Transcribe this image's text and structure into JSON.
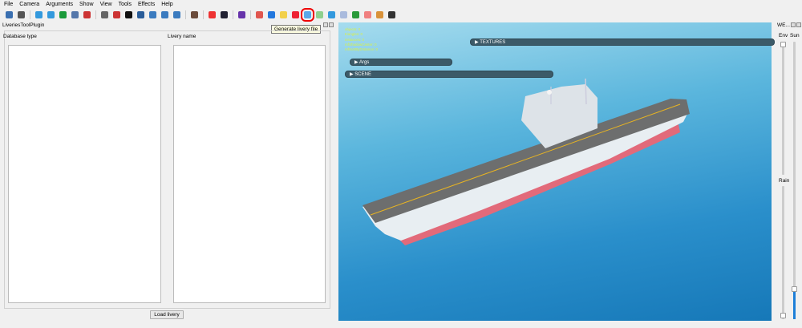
{
  "menu": [
    "File",
    "Camera",
    "Arguments",
    "Show",
    "View",
    "Tools",
    "Effects",
    "Help"
  ],
  "toolbar": {
    "icons": [
      {
        "name": "save-icon",
        "color": "#3a6fb0"
      },
      {
        "name": "user-icon",
        "color": "#555"
      },
      "sep",
      {
        "name": "globe-icon",
        "color": "#3399dd"
      },
      {
        "name": "refresh-icon",
        "color": "#3399dd"
      },
      {
        "name": "reload-icon",
        "color": "#1a9a3a"
      },
      {
        "name": "image-icon",
        "color": "#5577aa"
      },
      {
        "name": "run-icon",
        "color": "#cc3333"
      },
      "sep",
      {
        "name": "camera-icon",
        "color": "#666"
      },
      {
        "name": "crosshair-icon",
        "color": "#cc3333"
      },
      {
        "name": "grid-black-icon",
        "color": "#111"
      },
      {
        "name": "filter-icon",
        "color": "#2a5d99"
      },
      {
        "name": "figure-icon",
        "color": "#3b7bbf"
      },
      {
        "name": "arrow-right-icon",
        "color": "#3b7bbf"
      },
      {
        "name": "speaker-icon",
        "color": "#3b7bbf"
      },
      "sep",
      {
        "name": "texture-icon",
        "color": "#6b4b3b"
      },
      "sep",
      {
        "name": "colors-icon",
        "color": "#e33"
      },
      {
        "name": "monitor-icon",
        "color": "#223"
      },
      "sep",
      {
        "name": "undo-icon",
        "color": "#6633aa"
      },
      "sep",
      {
        "name": "bar-chart-icon",
        "color": "#e0564f"
      },
      {
        "name": "dot-icon",
        "color": "#2277dd"
      },
      {
        "name": "folder-icon",
        "color": "#f2d04a"
      },
      {
        "name": "record-icon",
        "color": "#e23"
      },
      {
        "name": "generate-livery-icon",
        "color": "#58a8e8",
        "highlight": true
      },
      {
        "name": "green-box-icon",
        "color": "#8ed08e"
      },
      {
        "name": "network-icon",
        "color": "#3399dd"
      },
      {
        "name": "list-icon",
        "color": "#aabbdd"
      },
      {
        "name": "matrix-icon",
        "color": "#2a9a3a"
      },
      {
        "name": "stop-icon",
        "color": "#f08080"
      },
      {
        "name": "layers-icon",
        "color": "#d9923a"
      },
      {
        "name": "plug-icon",
        "color": "#333"
      }
    ],
    "tooltip": "Generate livery file"
  },
  "left_panel": {
    "title": "LiveriesToolPlugin",
    "database_label": "Database type",
    "livery_label": "Livery name",
    "load_button": "Load livery"
  },
  "viewport": {
    "stats": [
      "objects: 0",
      "triangles: 0",
      "instances: 0",
      "mfShadowCaster: 0",
      "mfSortByDistance: 0"
    ],
    "panels": {
      "textures": "TEXTURES",
      "args": "Args",
      "scene": "SCENE"
    }
  },
  "weather": {
    "title": "WE...",
    "env_label": "Env",
    "sun_label": "Sun",
    "rain_label": "Rain",
    "env_value": 0,
    "sun_value": 0.1,
    "rain_value": 1.0,
    "accent": "#1e7fd8"
  }
}
